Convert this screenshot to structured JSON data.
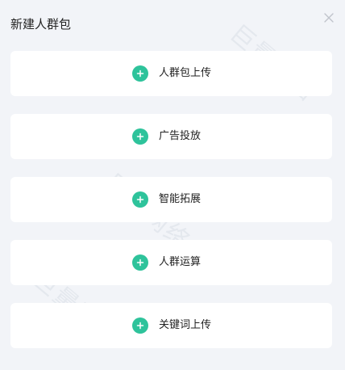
{
  "dialog": {
    "title": "新建人群包",
    "watermark": "巨量网络"
  },
  "options": [
    {
      "label": "人群包上传"
    },
    {
      "label": "广告投放"
    },
    {
      "label": "智能拓展"
    },
    {
      "label": "人群运算"
    },
    {
      "label": "关键词上传"
    }
  ],
  "colors": {
    "background": "#f2f4f8",
    "card": "#ffffff",
    "accent": "#2ec39b",
    "text": "#222222",
    "close_icon": "#c0c4cc"
  },
  "icons": {
    "close": "close-icon",
    "option": "plus-circle-icon"
  }
}
